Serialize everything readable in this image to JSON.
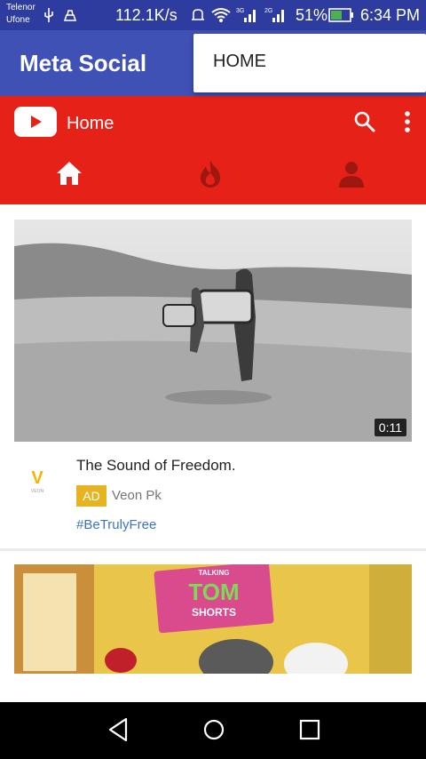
{
  "status_bar": {
    "carrier_1": "Telenor",
    "carrier_2": "Ufone",
    "speed": "112.1K/s",
    "battery": "51%",
    "time": "6:34 PM",
    "icons": [
      "usb-icon",
      "notification-icon",
      "alarm-icon",
      "wifi-icon",
      "signal-icon",
      "signal-icon",
      "battery-icon"
    ]
  },
  "app_bar": {
    "title": "Meta Social",
    "menu_item": "HOME"
  },
  "youtube": {
    "title": "Home",
    "icons": [
      "youtube-logo-icon",
      "search-icon",
      "more-vert-icon"
    ],
    "tabs": [
      "home-icon",
      "trending-icon",
      "account-icon"
    ]
  },
  "feed": {
    "items": [
      {
        "duration": "0:11",
        "title": "The Sound of Freedom.",
        "ad_label": "AD",
        "channel": "Veon Pk",
        "hashtag": "#BeTrulyFree",
        "logo_letter": "V",
        "logo_text": "VEON"
      },
      {
        "thumb_text_1": "TALKING",
        "thumb_text_2": "TOM",
        "thumb_text_3": "SHORTS"
      }
    ]
  },
  "colors": {
    "status_bar": "#2d3c9e",
    "app_bar": "#3f51b5",
    "youtube_red": "#e62117",
    "ad_badge": "#e6b422",
    "hashtag": "#3a74c6"
  }
}
